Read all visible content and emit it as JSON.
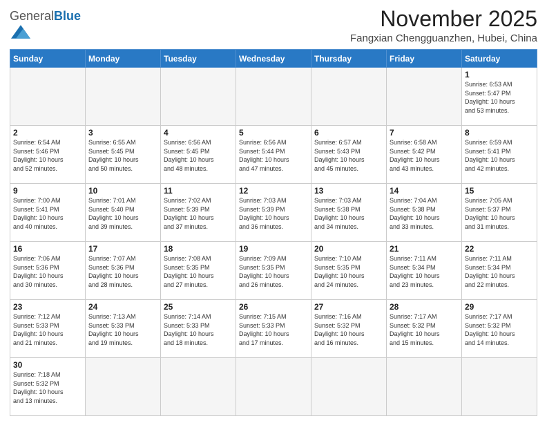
{
  "header": {
    "logo_general": "General",
    "logo_blue": "Blue",
    "month_year": "November 2025",
    "location": "Fangxian Chengguanzhen, Hubei, China"
  },
  "weekdays": [
    "Sunday",
    "Monday",
    "Tuesday",
    "Wednesday",
    "Thursday",
    "Friday",
    "Saturday"
  ],
  "weeks": [
    [
      {
        "day": "",
        "info": ""
      },
      {
        "day": "",
        "info": ""
      },
      {
        "day": "",
        "info": ""
      },
      {
        "day": "",
        "info": ""
      },
      {
        "day": "",
        "info": ""
      },
      {
        "day": "",
        "info": ""
      },
      {
        "day": "1",
        "info": "Sunrise: 6:53 AM\nSunset: 5:47 PM\nDaylight: 10 hours\nand 53 minutes."
      }
    ],
    [
      {
        "day": "2",
        "info": "Sunrise: 6:54 AM\nSunset: 5:46 PM\nDaylight: 10 hours\nand 52 minutes."
      },
      {
        "day": "3",
        "info": "Sunrise: 6:55 AM\nSunset: 5:45 PM\nDaylight: 10 hours\nand 50 minutes."
      },
      {
        "day": "4",
        "info": "Sunrise: 6:56 AM\nSunset: 5:45 PM\nDaylight: 10 hours\nand 48 minutes."
      },
      {
        "day": "5",
        "info": "Sunrise: 6:56 AM\nSunset: 5:44 PM\nDaylight: 10 hours\nand 47 minutes."
      },
      {
        "day": "6",
        "info": "Sunrise: 6:57 AM\nSunset: 5:43 PM\nDaylight: 10 hours\nand 45 minutes."
      },
      {
        "day": "7",
        "info": "Sunrise: 6:58 AM\nSunset: 5:42 PM\nDaylight: 10 hours\nand 43 minutes."
      },
      {
        "day": "8",
        "info": "Sunrise: 6:59 AM\nSunset: 5:41 PM\nDaylight: 10 hours\nand 42 minutes."
      }
    ],
    [
      {
        "day": "9",
        "info": "Sunrise: 7:00 AM\nSunset: 5:41 PM\nDaylight: 10 hours\nand 40 minutes."
      },
      {
        "day": "10",
        "info": "Sunrise: 7:01 AM\nSunset: 5:40 PM\nDaylight: 10 hours\nand 39 minutes."
      },
      {
        "day": "11",
        "info": "Sunrise: 7:02 AM\nSunset: 5:39 PM\nDaylight: 10 hours\nand 37 minutes."
      },
      {
        "day": "12",
        "info": "Sunrise: 7:03 AM\nSunset: 5:39 PM\nDaylight: 10 hours\nand 36 minutes."
      },
      {
        "day": "13",
        "info": "Sunrise: 7:03 AM\nSunset: 5:38 PM\nDaylight: 10 hours\nand 34 minutes."
      },
      {
        "day": "14",
        "info": "Sunrise: 7:04 AM\nSunset: 5:38 PM\nDaylight: 10 hours\nand 33 minutes."
      },
      {
        "day": "15",
        "info": "Sunrise: 7:05 AM\nSunset: 5:37 PM\nDaylight: 10 hours\nand 31 minutes."
      }
    ],
    [
      {
        "day": "16",
        "info": "Sunrise: 7:06 AM\nSunset: 5:36 PM\nDaylight: 10 hours\nand 30 minutes."
      },
      {
        "day": "17",
        "info": "Sunrise: 7:07 AM\nSunset: 5:36 PM\nDaylight: 10 hours\nand 28 minutes."
      },
      {
        "day": "18",
        "info": "Sunrise: 7:08 AM\nSunset: 5:35 PM\nDaylight: 10 hours\nand 27 minutes."
      },
      {
        "day": "19",
        "info": "Sunrise: 7:09 AM\nSunset: 5:35 PM\nDaylight: 10 hours\nand 26 minutes."
      },
      {
        "day": "20",
        "info": "Sunrise: 7:10 AM\nSunset: 5:35 PM\nDaylight: 10 hours\nand 24 minutes."
      },
      {
        "day": "21",
        "info": "Sunrise: 7:11 AM\nSunset: 5:34 PM\nDaylight: 10 hours\nand 23 minutes."
      },
      {
        "day": "22",
        "info": "Sunrise: 7:11 AM\nSunset: 5:34 PM\nDaylight: 10 hours\nand 22 minutes."
      }
    ],
    [
      {
        "day": "23",
        "info": "Sunrise: 7:12 AM\nSunset: 5:33 PM\nDaylight: 10 hours\nand 21 minutes."
      },
      {
        "day": "24",
        "info": "Sunrise: 7:13 AM\nSunset: 5:33 PM\nDaylight: 10 hours\nand 19 minutes."
      },
      {
        "day": "25",
        "info": "Sunrise: 7:14 AM\nSunset: 5:33 PM\nDaylight: 10 hours\nand 18 minutes."
      },
      {
        "day": "26",
        "info": "Sunrise: 7:15 AM\nSunset: 5:33 PM\nDaylight: 10 hours\nand 17 minutes."
      },
      {
        "day": "27",
        "info": "Sunrise: 7:16 AM\nSunset: 5:32 PM\nDaylight: 10 hours\nand 16 minutes."
      },
      {
        "day": "28",
        "info": "Sunrise: 7:17 AM\nSunset: 5:32 PM\nDaylight: 10 hours\nand 15 minutes."
      },
      {
        "day": "29",
        "info": "Sunrise: 7:17 AM\nSunset: 5:32 PM\nDaylight: 10 hours\nand 14 minutes."
      }
    ],
    [
      {
        "day": "30",
        "info": "Sunrise: 7:18 AM\nSunset: 5:32 PM\nDaylight: 10 hours\nand 13 minutes."
      },
      {
        "day": "",
        "info": ""
      },
      {
        "day": "",
        "info": ""
      },
      {
        "day": "",
        "info": ""
      },
      {
        "day": "",
        "info": ""
      },
      {
        "day": "",
        "info": ""
      },
      {
        "day": "",
        "info": ""
      }
    ]
  ]
}
